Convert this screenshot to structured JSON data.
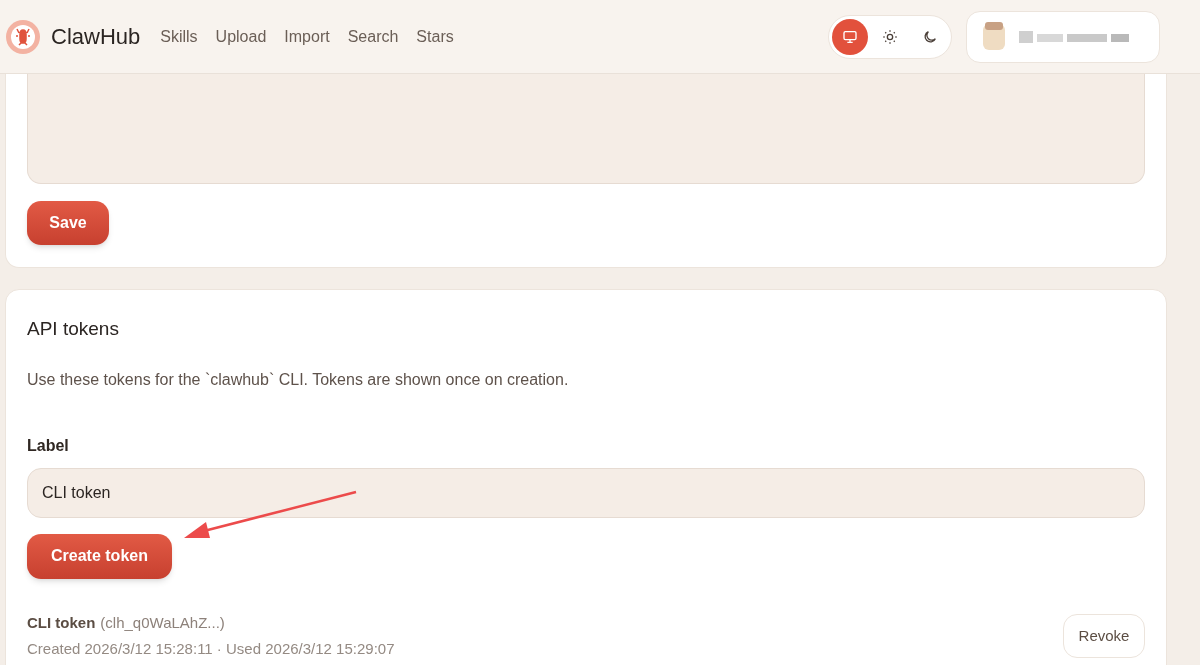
{
  "header": {
    "brand": "ClawHub",
    "nav": [
      "Skills",
      "Upload",
      "Import",
      "Search",
      "Stars"
    ],
    "theme_options": [
      {
        "kind": "system",
        "selected": true
      },
      {
        "kind": "light",
        "selected": false
      },
      {
        "kind": "dark",
        "selected": false
      }
    ]
  },
  "profile_card": {
    "save_button": "Save"
  },
  "api_tokens": {
    "title": "API tokens",
    "description": "Use these tokens for the `clawhub` CLI. Tokens are shown once on creation.",
    "label": "Label",
    "label_value": "CLI token",
    "create_button": "Create token",
    "tokens": [
      {
        "name": "CLI token",
        "prefix": "(clh_q0WaLAhZ...)",
        "meta": "Created 2026/3/12 15:28:11 · Used 2026/3/12 15:29:07",
        "revoke": "Revoke"
      }
    ]
  }
}
